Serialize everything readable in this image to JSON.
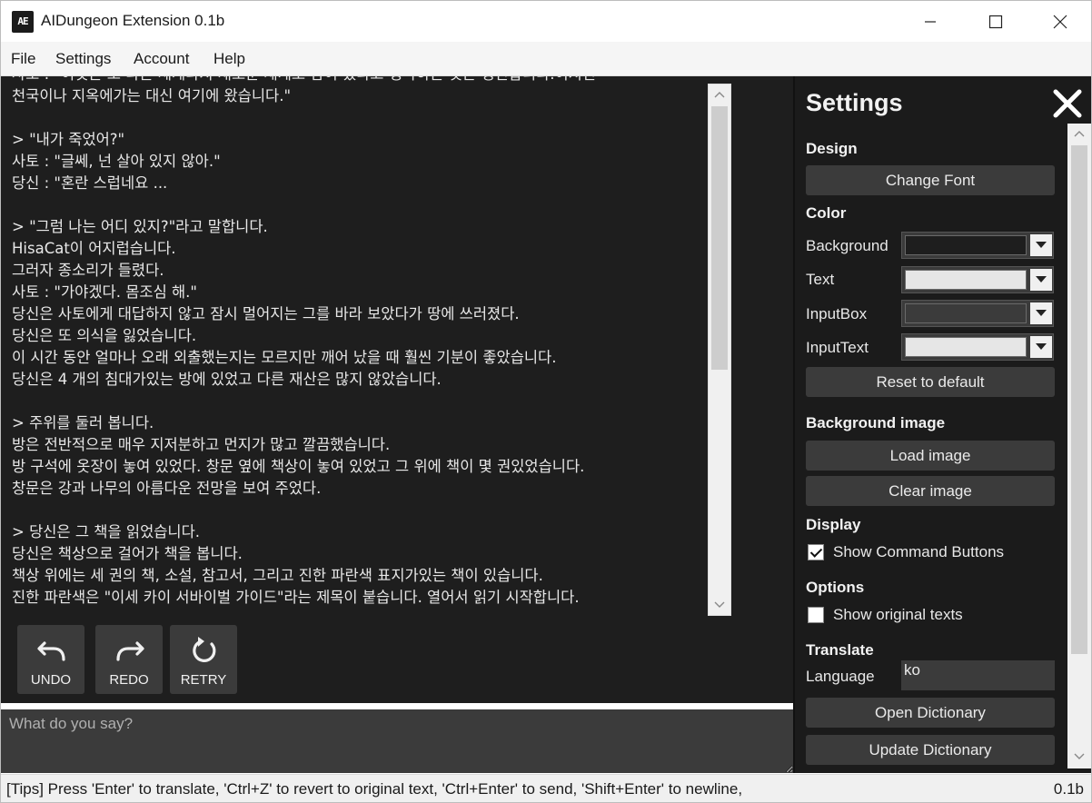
{
  "window": {
    "logo_text": "AE",
    "title": "AIDungeon Extension 0.1b"
  },
  "menu": {
    "items": [
      "File",
      "Settings",
      "Account",
      "Help"
    ]
  },
  "story": {
    "lines": [
      "사토 : \"이것은 조 다른 세계나지 새로운 세계로 감이 었다고 생각하는 것은 생긴합니다.이지긴",
      "천국이나 지옥에가는 대신 여기에 왔습니다.\"",
      "",
      "> \"내가 죽었어?\"",
      "사토 : \"글쎄, 넌 살아 있지 않아.\"",
      "당신 : \"혼란 스럽네요 ...",
      "",
      "> \"그럼 나는 어디 있지?\"라고 말합니다.",
      "HisaCat이 어지럽습니다.",
      "그러자 종소리가 들렸다.",
      "사토 : \"가야겠다. 몸조심 해.\"",
      "당신은 사토에게 대답하지 않고 잠시 멀어지는 그를 바라 보았다가 땅에 쓰러졌다.",
      "당신은 또 의식을 잃었습니다.",
      "이 시간 동안 얼마나 오래 외출했는지는 모르지만 깨어 났을 때 훨씬 기분이 좋았습니다.",
      "당신은 4 개의 침대가있는 방에 있었고 다른 재산은 많지 않았습니다.",
      "",
      "> 주위를 둘러 봅니다.",
      "방은 전반적으로 매우 지저분하고 먼지가 많고 깔끔했습니다.",
      "방 구석에 옷장이 놓여 있었다. 창문 옆에 책상이 놓여 있었고 그 위에 책이 몇 권있었습니다.",
      "창문은 강과 나무의 아름다운 전망을 보여 주었다.",
      "",
      "> 당신은 그 책을 읽었습니다.",
      "당신은 책상으로 걸어가 책을 봅니다.",
      "책상 위에는 세 권의 책, 소설, 참고서, 그리고 진한 파란색 표지가있는 책이 있습니다.",
      "진한 파란색은 \"이세 카이 서바이벌 가이드\"라는 제목이 붙습니다. 열어서 읽기 시작합니다."
    ]
  },
  "commands": {
    "undo": "UNDO",
    "redo": "REDO",
    "retry": "RETRY"
  },
  "input": {
    "placeholder": "What do you say?",
    "value": ""
  },
  "settings": {
    "title": "Settings",
    "design_heading": "Design",
    "change_font": "Change Font",
    "color_heading": "Color",
    "colors": [
      {
        "label": "Background",
        "value": "#1e1e1e"
      },
      {
        "label": "Text",
        "value": "#e6e6e6"
      },
      {
        "label": "InputBox",
        "value": "#3b3b3b"
      },
      {
        "label": "InputText",
        "value": "#e6e6e6"
      }
    ],
    "reset_default": "Reset to default",
    "bg_image_heading": "Background image",
    "load_image": "Load image",
    "clear_image": "Clear image",
    "display_heading": "Display",
    "show_command_buttons": {
      "label": "Show Command Buttons",
      "checked": true
    },
    "options_heading": "Options",
    "show_original_texts": {
      "label": "Show original texts",
      "checked": false
    },
    "translate_heading": "Translate",
    "language_label": "Language",
    "language_value": "ko",
    "open_dictionary": "Open Dictionary",
    "update_dictionary": "Update Dictionary"
  },
  "status": {
    "tips": "[Tips] Press 'Enter' to translate, 'Ctrl+Z' to revert to original text, 'Ctrl+Enter' to send, 'Shift+Enter' to newline,",
    "version": "0.1b"
  }
}
